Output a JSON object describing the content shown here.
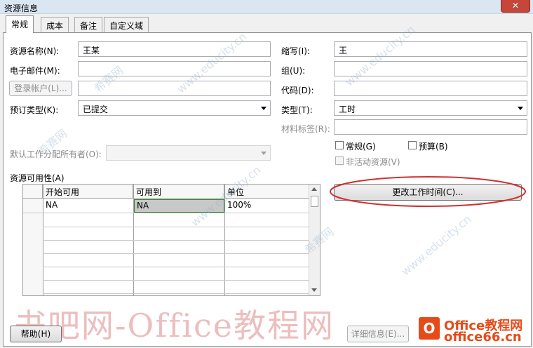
{
  "window": {
    "title": "资源信息",
    "close_glyph": "✕"
  },
  "tabs": [
    {
      "label": "常规",
      "active": true
    },
    {
      "label": "成本"
    },
    {
      "label": "备注"
    },
    {
      "label": "自定义域"
    }
  ],
  "fields": {
    "resource_name": {
      "label": "资源名称(N):",
      "value": "王某"
    },
    "email": {
      "label": "电子邮件(M):",
      "value": ""
    },
    "login_button": "登录帐户(L)...",
    "booking_type": {
      "label": "预订类型(K):",
      "value": "已提交"
    },
    "default_owner": {
      "label": "默认工作分配所有者(O):",
      "value": ""
    },
    "initials": {
      "label": "缩写(I):",
      "value": "王"
    },
    "group": {
      "label": "组(U):",
      "value": ""
    },
    "code": {
      "label": "代码(D):",
      "value": ""
    },
    "type": {
      "label": "类型(T):",
      "value": "工时"
    },
    "material_label": {
      "label": "材料标签(R):",
      "value": ""
    }
  },
  "checkboxes": {
    "generic": "常规(G)",
    "budget": "预算(B)",
    "inactive": "非活动资源(V)"
  },
  "availability": {
    "label": "资源可用性(A)",
    "columns": [
      "开始可用",
      "可用到",
      "单位"
    ],
    "rows": [
      [
        "NA",
        "NA",
        "100%"
      ]
    ]
  },
  "change_working_time_button": "更改工作时间(C)...",
  "footer": {
    "help_button": "帮助(H)",
    "details_button": "详细信息(E)..."
  },
  "watermarks": {
    "banner": "书吧网-Office教程网",
    "logo_letter": "O",
    "logo_line1": "Office教程网",
    "logo_line2": "office66.cn",
    "site": "www.educity.cn",
    "brand": "希赛网"
  },
  "colors": {
    "highlight_ellipse": "#d32f2f",
    "selected_cell": "#c8c8c8",
    "selected_border": "#2e7d32"
  }
}
